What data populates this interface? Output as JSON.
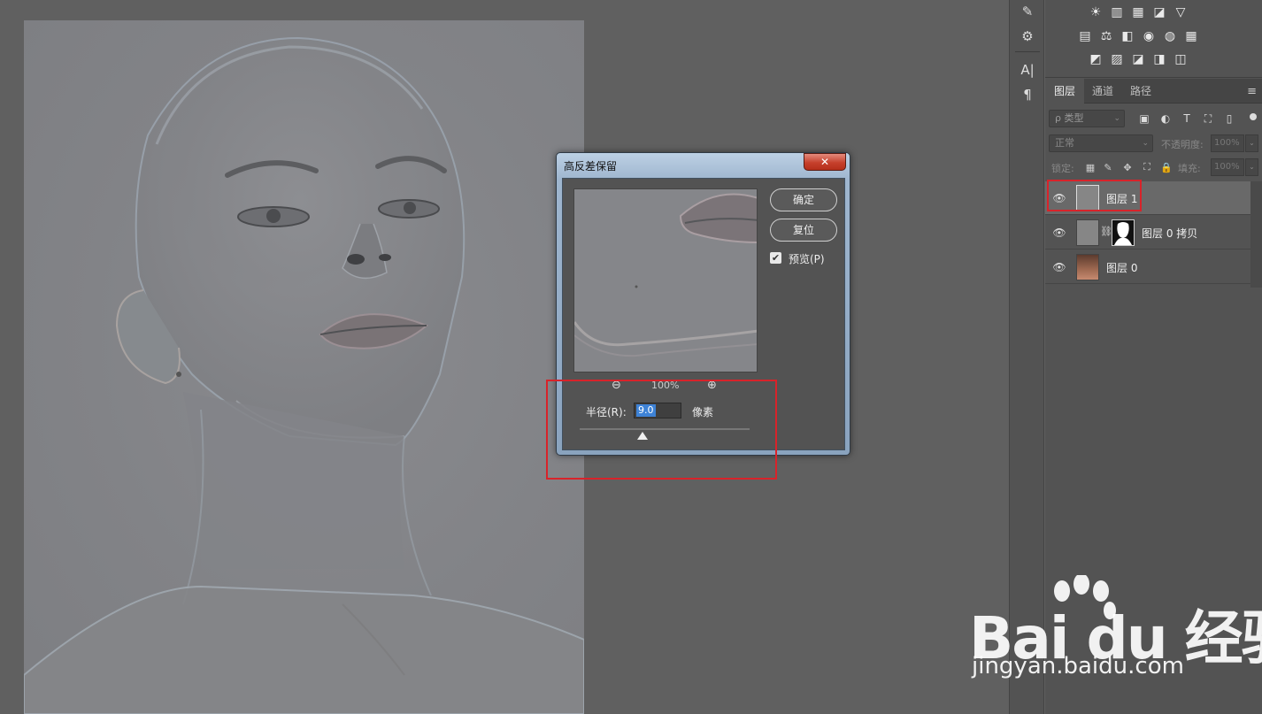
{
  "dialog": {
    "title": "高反差保留",
    "close_glyph": "✕",
    "ok_label": "确定",
    "reset_label": "复位",
    "preview_label": "预览(P)",
    "preview_checked": "✔",
    "zoom_out_icon": "zoom-out-icon",
    "zoom_in_icon": "zoom-in-icon",
    "zoom_out_glyph": "⊖",
    "zoom_in_glyph": "⊕",
    "zoom_value": "100%",
    "radius_label": "半径(R):",
    "radius_value": "9.0",
    "radius_unit": "像素"
  },
  "layers_panel": {
    "tabs": [
      {
        "label": "图层",
        "active": true
      },
      {
        "label": "通道",
        "active": false
      },
      {
        "label": "路径",
        "active": false
      }
    ],
    "menu_glyph": "≡",
    "filter_placeholder": "ρ 类型",
    "filter_chevron": "⌄",
    "filter_icons": [
      "▣",
      "◐",
      "T",
      "⛶",
      "▯"
    ],
    "blend_mode": "正常",
    "opacity_label": "不透明度:",
    "opacity_value": "100%",
    "lock_label": "锁定:",
    "lock_icons": [
      "▦",
      "✎",
      "✥",
      "⛶",
      "🔒"
    ],
    "fill_label": "填充:",
    "fill_value": "100%",
    "dropdown_glyph": "⌄",
    "eye_glyph": "👁",
    "chain_glyph": "⛓",
    "layers": [
      {
        "name": "图层 1",
        "selected": true
      },
      {
        "name": "图层 0 拷贝",
        "selected": false
      },
      {
        "name": "图层 0",
        "selected": false
      }
    ]
  },
  "adjustments": {
    "row1": [
      "☀",
      "▥",
      "▦",
      "◪",
      "▽"
    ],
    "row2": [
      "▤",
      "⚖",
      "◧",
      "◉",
      "◍",
      "▦"
    ],
    "row3": [
      "◩",
      "▨",
      "◪",
      "◨",
      "◫"
    ]
  },
  "tool_strip": [
    "✎",
    "⚙",
    "A|",
    "¶"
  ],
  "watermark": {
    "logo": "Bai du 经验",
    "url": "jingyan.baidu.com"
  },
  "colors": {
    "highlight": "#d8232a",
    "selection_blue": "#3d82d6"
  }
}
